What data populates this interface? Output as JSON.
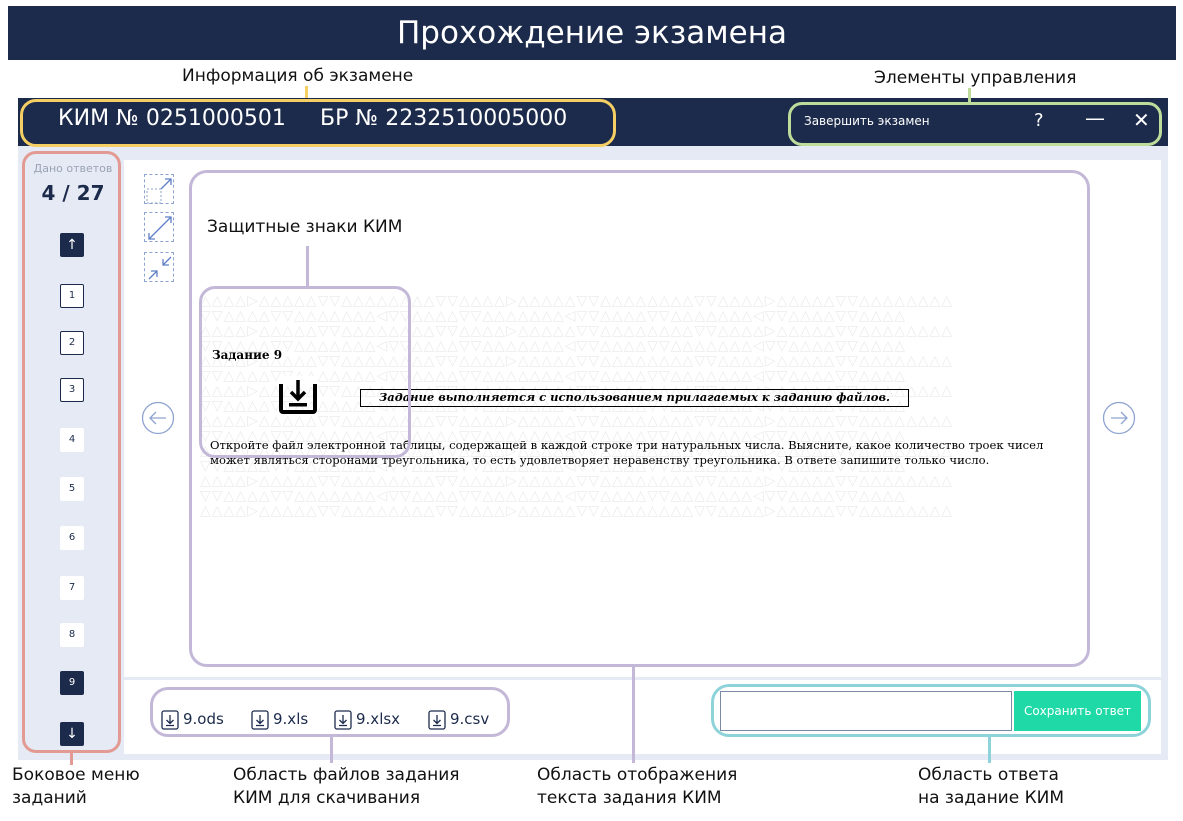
{
  "page": {
    "title": "Прохождение экзамена"
  },
  "captions": {
    "exam_info": "Информация об экзамене",
    "controls": "Элементы управления",
    "security_marks": "Защитные знаки КИМ",
    "sidebar_l1": "Боковое меню",
    "sidebar_l2": "заданий",
    "files_l1": "Область файлов задания",
    "files_l2": "КИМ для скачивания",
    "text_l1": "Область отображения",
    "text_l2": "текста задания КИМ",
    "answer_l1": "Область ответа",
    "answer_l2": "на задание КИМ"
  },
  "header": {
    "kim": "КИМ № 0251000501",
    "br": "БР № 2232510005000",
    "finish_label": "Завершить экзамен",
    "help_label": "?",
    "minimize_label": "—",
    "close_label": "✕"
  },
  "sidebar": {
    "answered_label": "Дано ответов",
    "answered_count": "4 / 27",
    "up_label": "↑",
    "down_label": "↓",
    "items": [
      {
        "label": "1",
        "answered": true
      },
      {
        "label": "2",
        "answered": true
      },
      {
        "label": "3",
        "answered": true
      },
      {
        "label": "4",
        "answered": false
      },
      {
        "label": "5",
        "answered": false
      },
      {
        "label": "6",
        "answered": false
      },
      {
        "label": "7",
        "answered": false
      },
      {
        "label": "8",
        "answered": false
      },
      {
        "label": "9",
        "answered": false,
        "current": true
      }
    ]
  },
  "task": {
    "title": "Задание 9",
    "banner": "Задание выполняется с использованием прилагаемых к заданию файлов.",
    "body": "Откройте файл электронной таблицы, содержащей в каждой строке три натуральных числа. Выясните, какое количество троек чисел может являться сторонами треугольника, то есть удовлетворяет неравенству треугольника. В ответе запишите только число."
  },
  "files": [
    "9.ods",
    "9.xls",
    "9.xlsx",
    "9.csv"
  ],
  "answer": {
    "value": "",
    "placeholder": "",
    "save_label": "Сохранить ответ"
  },
  "colors": {
    "navy": "#1c2b4b",
    "panel_bg": "#e6eaf4",
    "save_green": "#1fd9a7",
    "outline_yellow": "#f5cf63",
    "outline_green": "#bfdc9b",
    "outline_red": "#e29a92",
    "outline_purple": "#c4b8d8",
    "outline_teal": "#8fd3da"
  }
}
